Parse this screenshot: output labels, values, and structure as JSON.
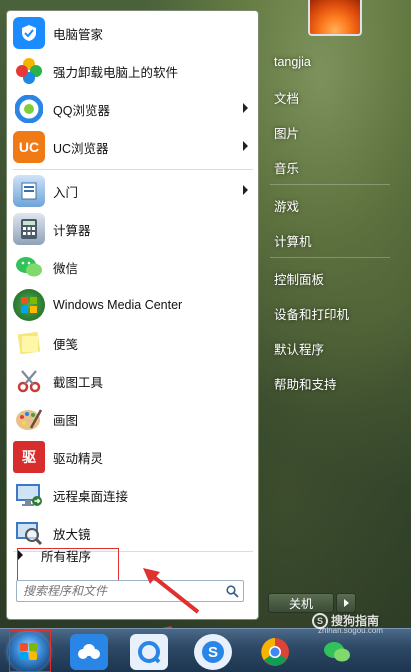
{
  "programs": [
    {
      "label": "电脑管家",
      "icon": "shield-icon",
      "color": "#1a8cff"
    },
    {
      "label": "强力卸载电脑上的软件",
      "icon": "clover-icon",
      "color": "#f5b400"
    },
    {
      "label": "QQ浏览器",
      "icon": "qq-browser-icon",
      "color": "#2a86e6",
      "submenu": true
    },
    {
      "label": "UC浏览器",
      "icon": "uc-browser-icon",
      "color": "#f07a15",
      "submenu": true
    },
    {
      "label": "入门",
      "icon": "getting-started-icon",
      "color": "#4d8ed1",
      "submenu": true
    },
    {
      "label": "计算器",
      "icon": "calculator-icon",
      "color": "#6f8aa6"
    },
    {
      "label": "微信",
      "icon": "wechat-icon",
      "color": "#32c25a"
    },
    {
      "label": "Windows Media Center",
      "icon": "media-center-icon",
      "color": "#2d8a2d"
    },
    {
      "label": "便笺",
      "icon": "sticky-notes-icon",
      "color": "#e6d94f"
    },
    {
      "label": "截图工具",
      "icon": "scissors-icon",
      "color": "#c73b3b"
    },
    {
      "label": "画图",
      "icon": "paint-icon",
      "color": "#d8a040"
    },
    {
      "label": "驱动精灵",
      "icon": "driver-genius-icon",
      "color": "#d72d2d"
    },
    {
      "label": "远程桌面连接",
      "icon": "remote-desktop-icon",
      "color": "#3b78c7"
    },
    {
      "label": "放大镜",
      "icon": "magnifier-icon",
      "color": "#3b78c7"
    }
  ],
  "all_programs_label": "所有程序",
  "search": {
    "placeholder": "搜索程序和文件"
  },
  "right_menu": {
    "items": [
      "tangjia",
      "文档",
      "图片",
      "音乐",
      "游戏",
      "计算机",
      "控制面板",
      "设备和打印机",
      "默认程序",
      "帮助和支持"
    ]
  },
  "shutdown_label": "关机",
  "watermark": {
    "text": "搜狗指南",
    "sub": "zhinan.sogou.com"
  },
  "colors": {
    "highlight": "#e03030",
    "accent": "#2e4a66"
  }
}
